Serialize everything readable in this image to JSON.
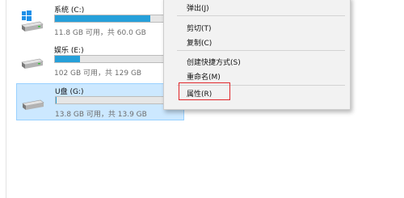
{
  "drives": [
    {
      "name": "系统 (C:)",
      "space_text": "11.8 GB 可用，共 60.0 GB",
      "used_fraction": 0.8,
      "icon": "windows-system-drive-icon"
    },
    {
      "name": "娱乐 (E:)",
      "space_text": "102 GB 可用，共 129 GB",
      "used_fraction": 0.21,
      "icon": "hard-drive-icon"
    },
    {
      "name": "U盘 (G:)",
      "space_text": "13.8 GB 可用，共 13.9 GB",
      "used_fraction": 0.01,
      "icon": "usb-drive-icon",
      "selected": true
    }
  ],
  "context_menu": {
    "items": [
      {
        "label": "弹出(J)"
      },
      {
        "label": "剪切(T)"
      },
      {
        "label": "复制(C)"
      },
      {
        "label": "创建快捷方式(S)"
      },
      {
        "label": "重命名(M)"
      },
      {
        "label": "属性(R)",
        "highlighted": true
      }
    ]
  },
  "colors": {
    "bar_fill": "#26a0da",
    "selection_bg": "#cce8ff",
    "selection_border": "#99d1ff",
    "highlight_box": "#e0262a"
  }
}
